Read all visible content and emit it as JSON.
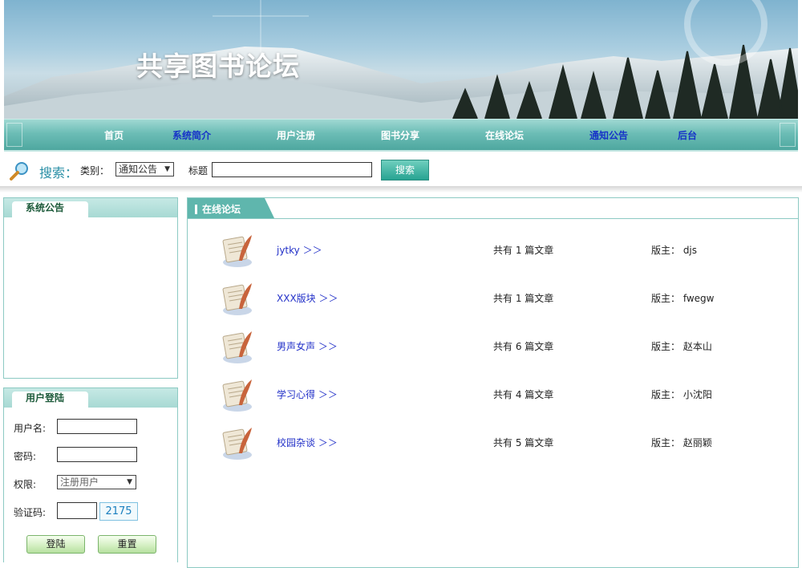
{
  "header": {
    "site_title": "共享图书论坛"
  },
  "nav": {
    "items": [
      {
        "label": "首页",
        "color": "#ffffff"
      },
      {
        "label": "系统简介",
        "color": "#1733c8"
      },
      {
        "label": "用户注册",
        "color": "#ffffff"
      },
      {
        "label": "图书分享",
        "color": "#ffffff"
      },
      {
        "label": "在线论坛",
        "color": "#ffffff"
      },
      {
        "label": "通知公告",
        "color": "#1733c8"
      },
      {
        "label": "后台",
        "color": "#1733c8"
      }
    ]
  },
  "search": {
    "label": "搜索：",
    "category_label": "类别：",
    "category_value": "通知公告",
    "title_label": "标题",
    "title_value": "",
    "button_label": "搜索"
  },
  "sidebar": {
    "notice_title": "系统公告",
    "login": {
      "title": "用户登陆",
      "username_label": "用户名:",
      "username_value": "",
      "password_label": "密码:",
      "password_value": "",
      "role_label": "权限:",
      "role_value": "注册用户",
      "captcha_label": "验证码:",
      "captcha_value": "",
      "captcha_code": "2175",
      "login_button": "登陆",
      "reset_button": "重置"
    }
  },
  "forum": {
    "title": "在线论坛",
    "boards": [
      {
        "name": "jytky ＞＞",
        "count": "共有 1 篇文章",
        "moderator": "版主： djs"
      },
      {
        "name": "XXX版块 ＞＞",
        "count": "共有 1 篇文章",
        "moderator": "版主： fwegw"
      },
      {
        "name": "男声女声 ＞＞",
        "count": "共有 6 篇文章",
        "moderator": "版主： 赵本山"
      },
      {
        "name": "学习心得 ＞＞",
        "count": "共有 4 篇文章",
        "moderator": "版主： 小沈阳"
      },
      {
        "name": "校园杂谈 ＞＞",
        "count": "共有 5 篇文章",
        "moderator": "版主： 赵丽颖"
      }
    ]
  },
  "colors": {
    "teal_accent": "#4ea79f",
    "link_blue": "#2230c8",
    "panel_border": "#8ccac3"
  }
}
